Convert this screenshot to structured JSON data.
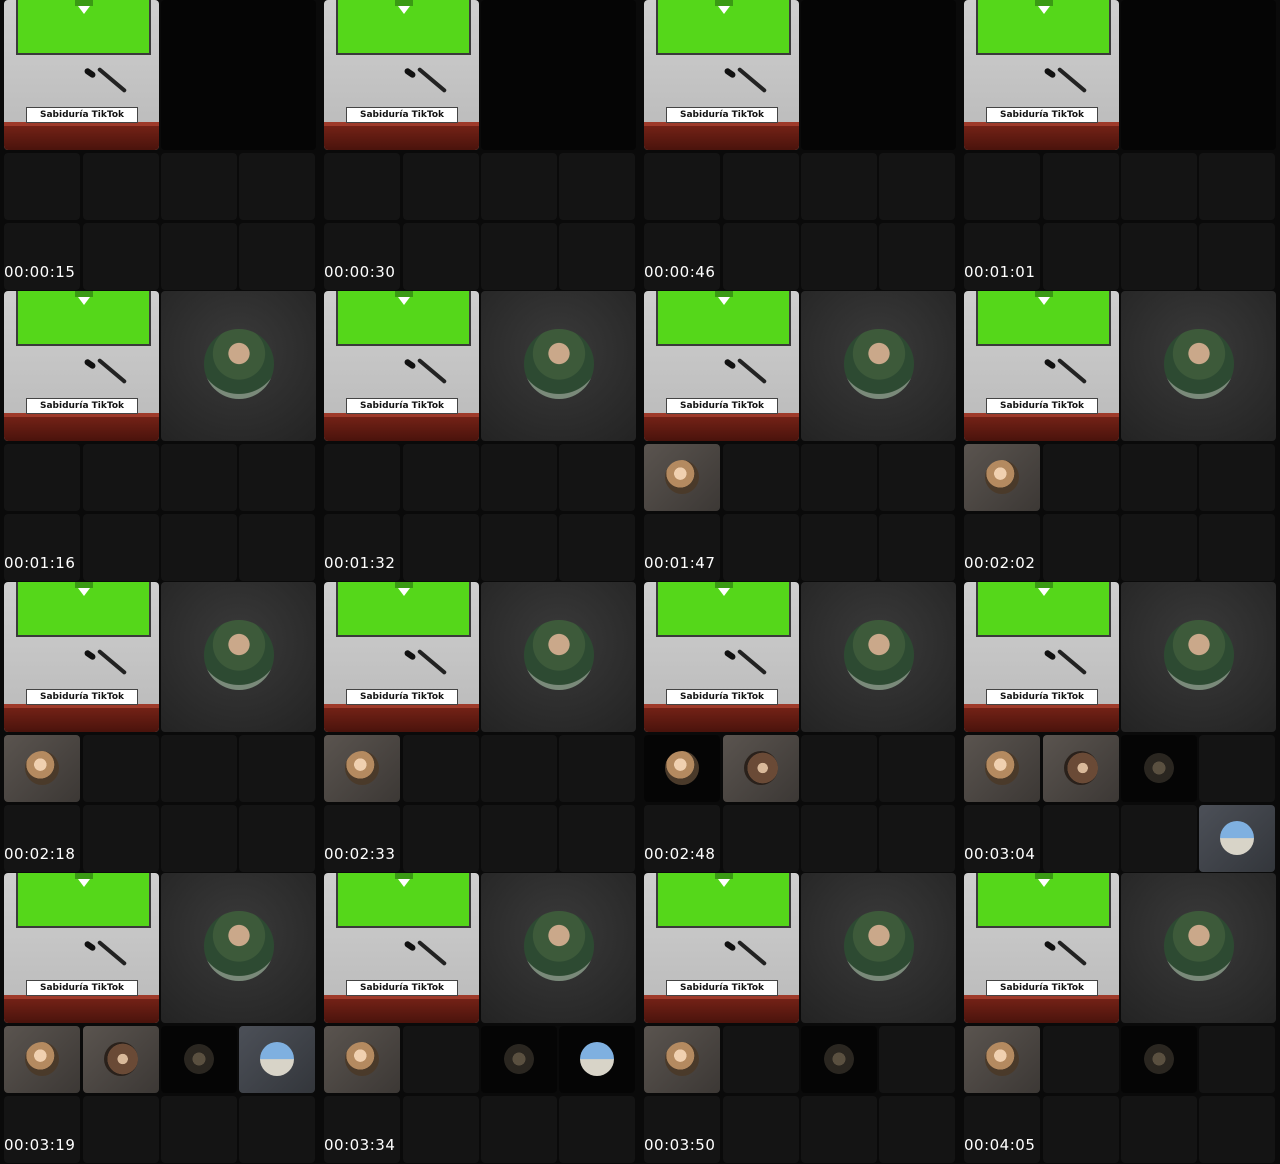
{
  "sign_text": "Sabiduría TikTok",
  "colors": {
    "background": "#000000",
    "tile": "#141414",
    "green_screen": "#55d71a",
    "podium": "#7a2418",
    "timestamp_text": "#ffffff"
  },
  "frames": [
    {
      "timestamp": "00:00:15",
      "speaker_visible": false,
      "participants": []
    },
    {
      "timestamp": "00:00:30",
      "speaker_visible": false,
      "participants": []
    },
    {
      "timestamp": "00:00:46",
      "speaker_visible": false,
      "participants": []
    },
    {
      "timestamp": "00:01:01",
      "speaker_visible": false,
      "participants": []
    },
    {
      "timestamp": "00:01:16",
      "speaker_visible": true,
      "participants": []
    },
    {
      "timestamp": "00:01:32",
      "speaker_visible": true,
      "participants": []
    },
    {
      "timestamp": "00:01:47",
      "speaker_visible": true,
      "participants": [
        "face"
      ]
    },
    {
      "timestamp": "00:02:02",
      "speaker_visible": true,
      "participants": [
        "face"
      ]
    },
    {
      "timestamp": "00:02:18",
      "speaker_visible": true,
      "participants": [
        "face"
      ]
    },
    {
      "timestamp": "00:02:33",
      "speaker_visible": true,
      "participants": [
        "face"
      ]
    },
    {
      "timestamp": "00:02:48",
      "speaker_visible": true,
      "participants": [
        "face-dark",
        "hair"
      ]
    },
    {
      "timestamp": "00:03:04",
      "speaker_visible": true,
      "participants": [
        "face",
        "hair",
        "dim",
        "sky-offset"
      ]
    },
    {
      "timestamp": "00:03:19",
      "speaker_visible": true,
      "participants": [
        "face",
        "hair",
        "dim",
        "sky"
      ]
    },
    {
      "timestamp": "00:03:34",
      "speaker_visible": true,
      "participants": [
        "face",
        "empty",
        "dim",
        "sky-dark"
      ]
    },
    {
      "timestamp": "00:03:50",
      "speaker_visible": true,
      "participants": [
        "face",
        "empty",
        "dim"
      ]
    },
    {
      "timestamp": "00:04:05",
      "speaker_visible": true,
      "participants": [
        "face",
        "empty",
        "dim"
      ]
    }
  ]
}
